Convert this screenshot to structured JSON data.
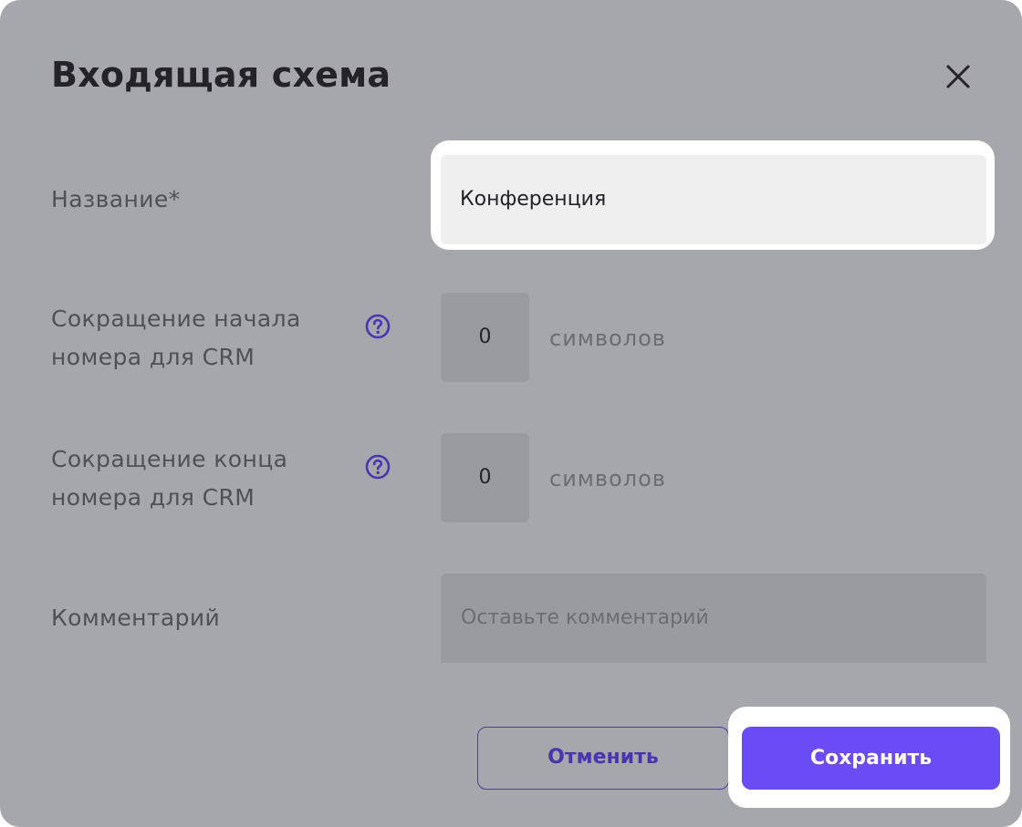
{
  "dialog": {
    "title": "Входящая схема",
    "close_icon": "close-icon"
  },
  "form": {
    "name": {
      "label": "Название*",
      "value": "Конференция"
    },
    "trim_start": {
      "label_line1": "Сокращение начала",
      "label_line2": "номера для CRM",
      "help_icon": "question-circle-icon",
      "value": "0",
      "unit": "символов"
    },
    "trim_end": {
      "label_line1": "Сокращение конца",
      "label_line2": "номера для CRM",
      "help_icon": "question-circle-icon",
      "value": "0",
      "unit": "символов"
    },
    "comment": {
      "label": "Комментарий",
      "placeholder": "Оставьте комментарий"
    }
  },
  "actions": {
    "cancel_label": "Отменить",
    "save_label": "Сохранить"
  },
  "colors": {
    "accent": "#6a4cf5",
    "accent_dark": "#4a35b0",
    "overlay": "#a6a7ac"
  }
}
